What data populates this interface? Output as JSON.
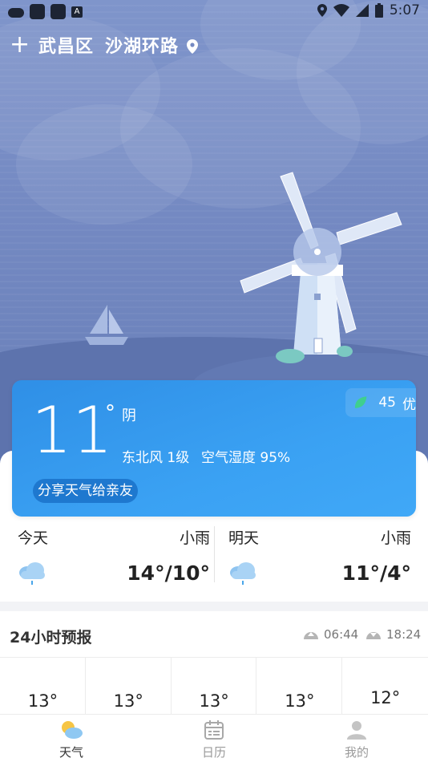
{
  "status_bar": {
    "time": "5:07"
  },
  "location": {
    "district": "武昌区",
    "street": "沙湖环路"
  },
  "current": {
    "temperature": "11",
    "degree": "°",
    "condition": "阴",
    "wind": "东北风 1级",
    "humidity": "空气湿度 95%",
    "share_label": "分享天气给亲友",
    "aqi_value": "45",
    "aqi_level": "优"
  },
  "today": {
    "name": "今天",
    "condition": "小雨",
    "temps": "14°/10°",
    "icon": "light-rain-icon"
  },
  "tomorrow": {
    "name": "明天",
    "condition": "小雨",
    "temps": "11°/4°",
    "icon": "light-rain-icon"
  },
  "forecast": {
    "title": "24小时预报",
    "sunrise": "06:44",
    "sunset": "18:24",
    "hours": [
      "13°",
      "13°",
      "13°",
      "13°",
      "12°"
    ]
  },
  "nav": [
    {
      "label": "天气",
      "icon": "weather-icon",
      "active": true
    },
    {
      "label": "日历",
      "icon": "calendar-icon",
      "active": false
    },
    {
      "label": "我的",
      "icon": "profile-icon",
      "active": false
    }
  ],
  "colors": {
    "card": "#3aa1f3",
    "accent": "#1e78cf",
    "hero": "#7489c2"
  }
}
